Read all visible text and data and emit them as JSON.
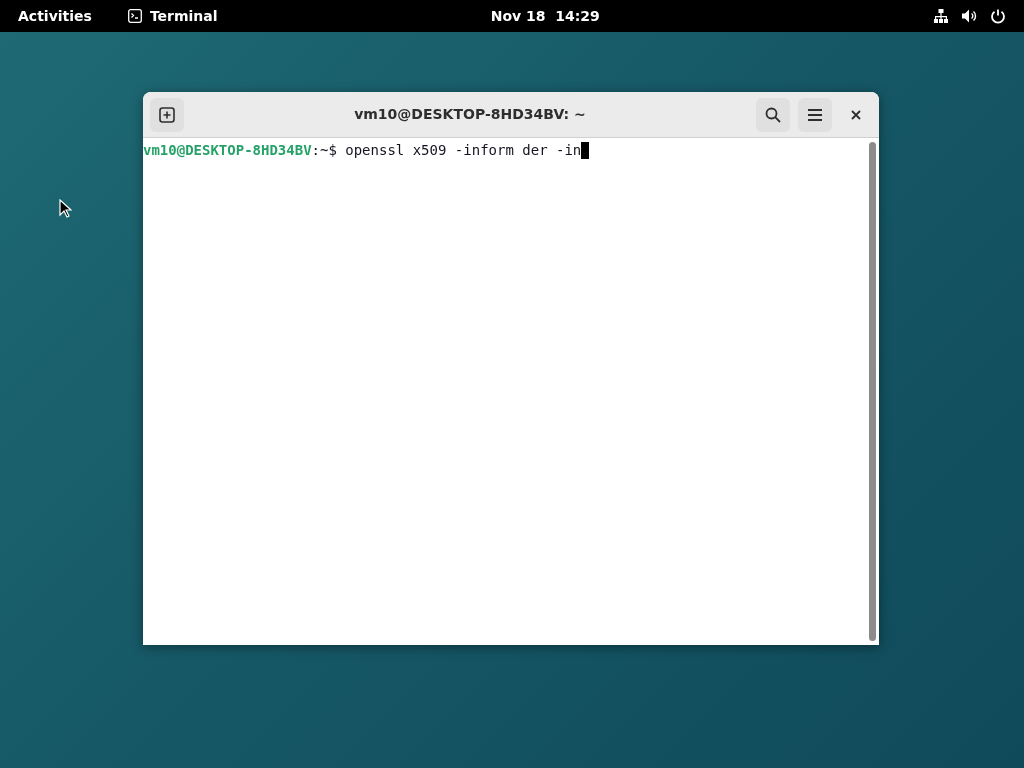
{
  "top_bar": {
    "activities": "Activities",
    "app_name": "Terminal",
    "clock": "Nov 18  14:29"
  },
  "terminal": {
    "title": "vm10@DESKTOP-8HD34BV: ~",
    "prompt_user": "vm10@DESKTOP-8HD34BV",
    "prompt_path": ":~$",
    "command": "openssl x509 -inform der -in"
  }
}
